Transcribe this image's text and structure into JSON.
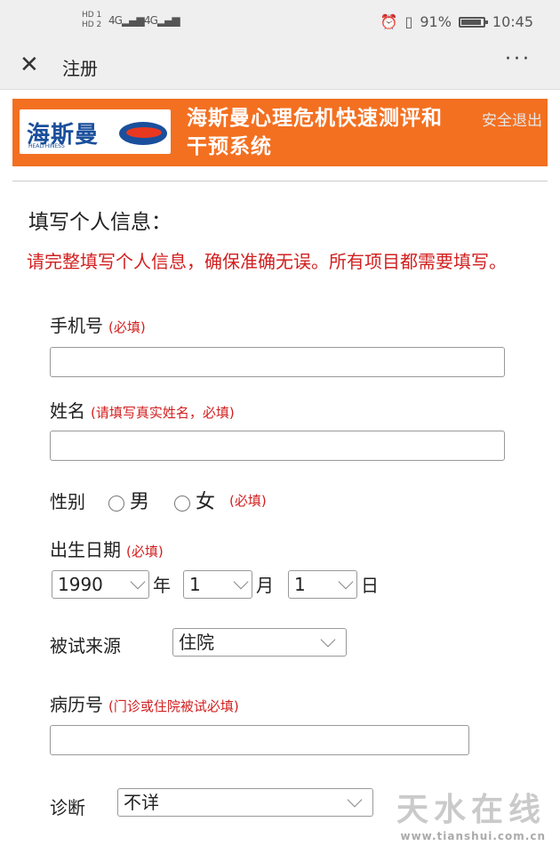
{
  "status_bar": {
    "sim1": "HD 1",
    "sim2": "HD 2",
    "signal1": "4G",
    "signal2": "4G",
    "battery": "91%",
    "time": "10:45"
  },
  "titlebar": {
    "close_glyph": "✕",
    "title": "注册",
    "more_glyph": "···"
  },
  "banner": {
    "logo_text": "海斯曼",
    "logo_subtext": "HEALTHINESS",
    "title": "海斯曼心理危机快速测评和干预系统",
    "logout": "安全退出"
  },
  "form": {
    "section_title": "填写个人信息：",
    "notice": "请完整填写个人信息，确保准确无误。所有项目都需要填写。",
    "phone": {
      "label": "手机号",
      "hint": "(必填)",
      "value": ""
    },
    "name": {
      "label": "姓名",
      "hint": "(请填写真实姓名，必填)",
      "value": ""
    },
    "gender": {
      "label": "性别",
      "options": [
        "男",
        "女"
      ],
      "hint": "(必填)"
    },
    "birth": {
      "label": "出生日期",
      "hint": "(必填)",
      "year": "1990",
      "year_unit": "年",
      "month": "1",
      "month_unit": "月",
      "day": "1",
      "day_unit": "日"
    },
    "source": {
      "label": "被试来源",
      "selected": "住院"
    },
    "record": {
      "label": "病历号",
      "hint": "(门诊或住院被试必填)",
      "value": ""
    },
    "diagnosis": {
      "label": "诊断",
      "selected": "不详"
    }
  },
  "watermark": {
    "text": "天水在线",
    "url": "www.tianshui.com.cn"
  }
}
